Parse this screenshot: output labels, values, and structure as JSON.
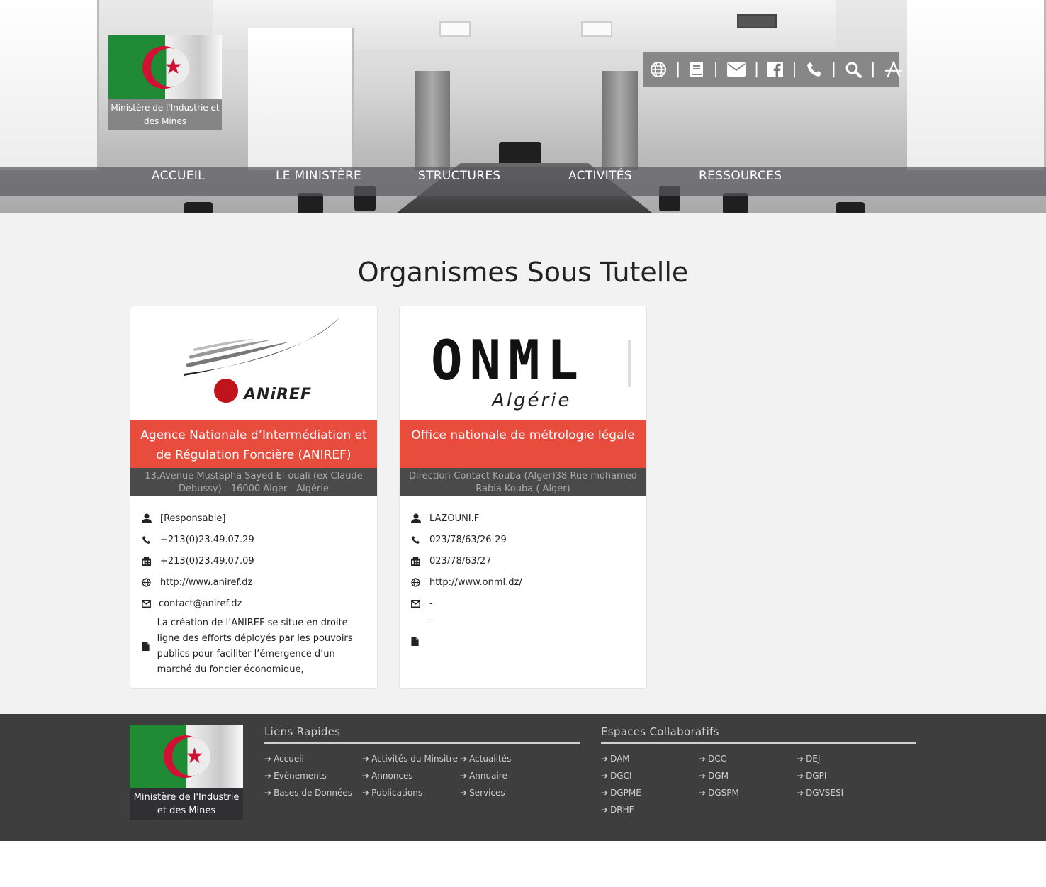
{
  "brand": {
    "caption": "Ministère de l'Industrie et des Mines"
  },
  "toolbar": {
    "icons": [
      "globe-icon",
      "book-icon",
      "envelope-icon",
      "facebook-icon",
      "phone-icon",
      "search-icon",
      "font-size-icon"
    ],
    "separator": "|"
  },
  "nav": {
    "items": [
      {
        "label": "ACCUEIL"
      },
      {
        "label": "LE MINISTÈRE"
      },
      {
        "label": "STRUCTURES"
      },
      {
        "label": "ACTIVITÉS"
      },
      {
        "label": "RESSOURCES"
      }
    ]
  },
  "main": {
    "title": "Organismes Sous Tutelle"
  },
  "cards": [
    {
      "logo_text": "ANiREF",
      "name": "Agence Nationale d’Intermédiation et de Régulation Foncière (ANIREF)",
      "address": "13,Avenue Mustapha Sayed El-ouali (ex Claude Debussy) - 16000 Alger - Algérie",
      "responsable": "[Responsable]",
      "phone": "+213(0)23.49.07.29",
      "fax": "+213(0)23.49.07.09",
      "website": "http://www.aniref.dz",
      "email": "contact@aniref.dz",
      "description": "La création de l’ANIREF se situe en droite ligne des efforts déployés par les pouvoirs publics pour faciliter l’émergence d’un marché du foncier économique,"
    },
    {
      "logo_text": "ONML",
      "logo_subtext": "Algérie",
      "name": "Office nationale de métrologie légale",
      "address": "Direction-Contact Kouba (Alger)38 Rue mohamed Rabia Kouba ( Alger)",
      "responsable": "LAZOUNI.F",
      "phone": "023/78/63/26-29",
      "fax": "023/78/63/27",
      "website": "http://www.onml.dz/",
      "email": "-",
      "extra": "--",
      "description": ""
    }
  ],
  "footer": {
    "caption": "Ministère de l'Industrie et des Mines",
    "quick_links": {
      "title": "Liens Rapides",
      "items": [
        "Accueil",
        "Activités du Minsitre",
        "Actualités",
        "Evènements",
        "Annonces",
        "Annuaire",
        "Bases de Données",
        "Publications",
        "Services"
      ]
    },
    "collab": {
      "title": "Espaces Collaboratifs",
      "items": [
        "DAM",
        "DCC",
        "DEJ",
        "DGCI",
        "DGM",
        "DGPI",
        "DGPME",
        "DGSPM",
        "DGVSESI",
        "DRHF"
      ]
    }
  },
  "colors": {
    "accent": "#e84c3d",
    "address_bar": "#4a4a4a",
    "footer_bg": "#3e3e3e",
    "content_bg": "#f2f2f2"
  }
}
